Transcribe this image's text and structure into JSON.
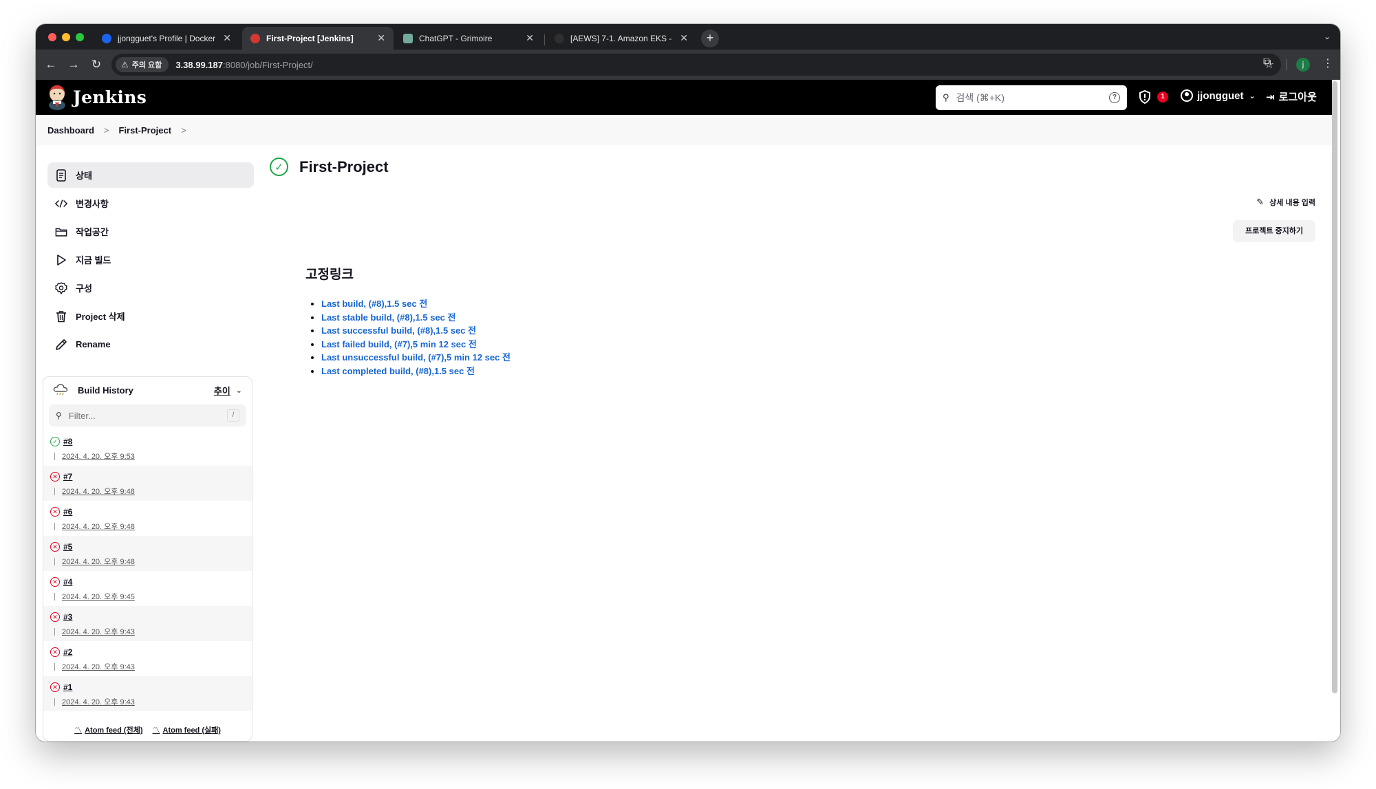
{
  "browser": {
    "tabs": [
      {
        "title": "jjongguet's Profile | Docker Hub",
        "active": false,
        "favicon_color": "#1d63ed"
      },
      {
        "title": "First-Project [Jenkins]",
        "active": true,
        "favicon_color": "#d33833"
      },
      {
        "title": "ChatGPT - Grimoire",
        "active": false,
        "favicon_color": "#74aa9c"
      },
      {
        "title": "[AEWS] 7-1. Amazon EKS - CI/CD",
        "active": false,
        "favicon_color": "#2f2f2f"
      }
    ],
    "new_tab": "+",
    "security_label": "주의 요함",
    "url_host": "3.38.99.187",
    "url_rest": ":8080/job/First-Project/",
    "profile_initial": "j"
  },
  "header": {
    "brand": "Jenkins",
    "search_placeholder": "검색 (⌘+K)",
    "security_badge_count": "1",
    "user_name": "jjongguet",
    "logout_label": "로그아웃"
  },
  "breadcrumb": {
    "items": [
      "Dashboard",
      "First-Project"
    ]
  },
  "sidebar": {
    "items": [
      {
        "label": "상태",
        "icon": "document-icon",
        "active": true
      },
      {
        "label": "변경사항",
        "icon": "code-icon",
        "active": false
      },
      {
        "label": "작업공간",
        "icon": "folder-icon",
        "active": false
      },
      {
        "label": "지금 빌드",
        "icon": "play-icon",
        "active": false
      },
      {
        "label": "구성",
        "icon": "gear-icon",
        "active": false
      },
      {
        "label": "Project 삭제",
        "icon": "trash-icon",
        "active": false
      },
      {
        "label": "Rename",
        "icon": "pencil-icon",
        "active": false
      }
    ]
  },
  "build_history": {
    "title": "Build History",
    "trend_label": "추이",
    "filter_placeholder": "Filter...",
    "filter_shortcut": "/",
    "builds": [
      {
        "number": "#8",
        "date": "2024. 4. 20. 오후 9:53",
        "status": "success"
      },
      {
        "number": "#7",
        "date": "2024. 4. 20. 오후 9:48",
        "status": "failed"
      },
      {
        "number": "#6",
        "date": "2024. 4. 20. 오후 9:48",
        "status": "failed"
      },
      {
        "number": "#5",
        "date": "2024. 4. 20. 오후 9:48",
        "status": "failed"
      },
      {
        "number": "#4",
        "date": "2024. 4. 20. 오후 9:45",
        "status": "failed"
      },
      {
        "number": "#3",
        "date": "2024. 4. 20. 오후 9:43",
        "status": "failed"
      },
      {
        "number": "#2",
        "date": "2024. 4. 20. 오후 9:43",
        "status": "failed"
      },
      {
        "number": "#1",
        "date": "2024. 4. 20. 오후 9:43",
        "status": "failed"
      }
    ],
    "feed_all": "Atom feed (전체)",
    "feed_failed": "Atom feed (실패)"
  },
  "main": {
    "project_title": "First-Project",
    "edit_description": "상세 내용 입력",
    "disable_project": "프로젝트 중지하기",
    "permalinks_title": "고정링크",
    "permalinks": [
      "Last build, (#8),1.5 sec 전",
      "Last stable build, (#8),1.5 sec 전",
      "Last successful build, (#8),1.5 sec 전",
      "Last failed build, (#7),5 min 12 sec 전",
      "Last unsuccessful build, (#7),5 min 12 sec 전",
      "Last completed build, (#8),1.5 sec 전"
    ]
  },
  "colors": {
    "link": "#1765d1",
    "success": "#1ea64b",
    "failure": "#e6001f",
    "header_bg": "#000000"
  }
}
